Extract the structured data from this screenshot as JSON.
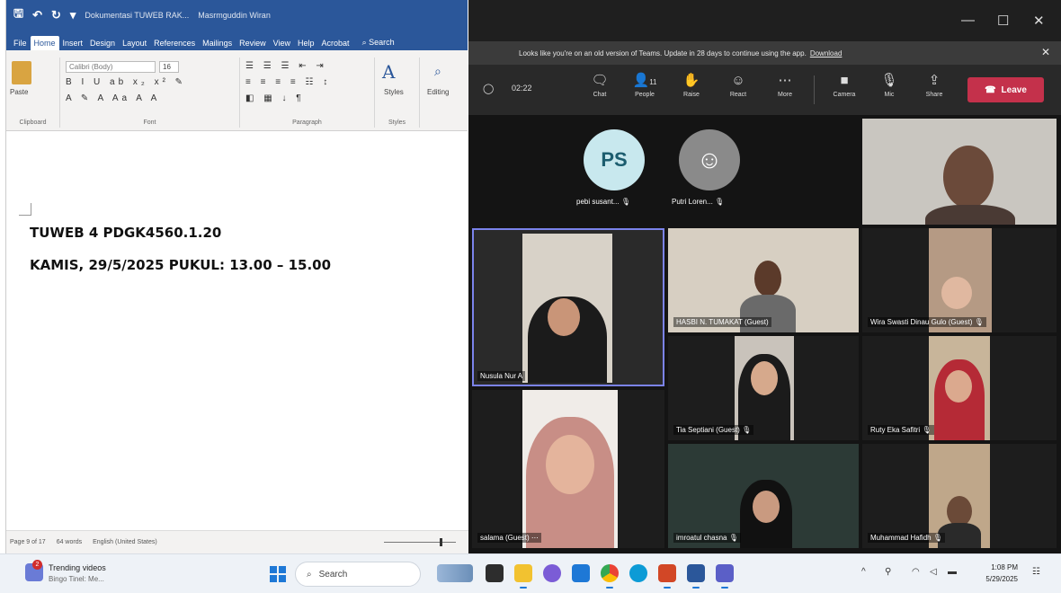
{
  "word": {
    "title_short": "Dokumentasi TUWEB RAK...",
    "user": "Masrmguddin Wiran",
    "tabs": [
      "File",
      "Home",
      "Insert",
      "Design",
      "Layout",
      "References",
      "Mailings",
      "Review",
      "View",
      "Help",
      "Acrobat"
    ],
    "search_label": "Search",
    "ribbon": {
      "paste": "Paste",
      "font_name": "Calibri (Body)",
      "font_size": "16",
      "styles": "Styles",
      "editing": "Editing",
      "groups": [
        "Clipboard",
        "Font",
        "Paragraph",
        "Styles"
      ]
    },
    "doc_lines": [
      "TUWEB 4 PDGK4560.1.20",
      "KAMIS, 29/5/2025 PUKUL: 13.00 – 15.00"
    ],
    "status": {
      "page": "Page 9 of 17",
      "words": "64 words",
      "language": "English (United States)"
    }
  },
  "teams": {
    "banner_text": "Looks like you're on an old version of Teams. Update in 28 days to continue using the app.",
    "banner_link": "Download",
    "timer": "02:22",
    "buttons": [
      {
        "label": "Chat",
        "icon": "chat-icon"
      },
      {
        "label": "People",
        "icon": "people-icon",
        "count": "11"
      },
      {
        "label": "Raise",
        "icon": "raise-hand-icon"
      },
      {
        "label": "React",
        "icon": "react-icon"
      },
      {
        "label": "More",
        "icon": "more-icon"
      },
      {
        "label": "Camera",
        "icon": "camera-icon"
      },
      {
        "label": "Mic",
        "icon": "mic-icon"
      },
      {
        "label": "Share",
        "icon": "share-icon"
      }
    ],
    "leave_label": "Leave",
    "leave_color": "#c4314b",
    "avatars": [
      {
        "initials": "PS",
        "name": "pebi susant..."
      },
      {
        "initials": "",
        "name": "Putri Loren..."
      }
    ],
    "participants": [
      "Nusula Nur A",
      "HASBI N. TUMAKAT (Guest)",
      "Wira Swasti Dinau Gulo (Guest)",
      "Tia Septiani (Guest)",
      "Ruty Eka Safitri",
      "salama (Guest)",
      "imroatul chasna",
      "Muhammad Hafidh"
    ]
  },
  "taskbar": {
    "widget_title": "Trending videos",
    "widget_sub": "Bingo Tinel: Me...",
    "widget_badge": "2",
    "search": "Search",
    "time": "1:08 PM",
    "date": "5/29/2025"
  }
}
